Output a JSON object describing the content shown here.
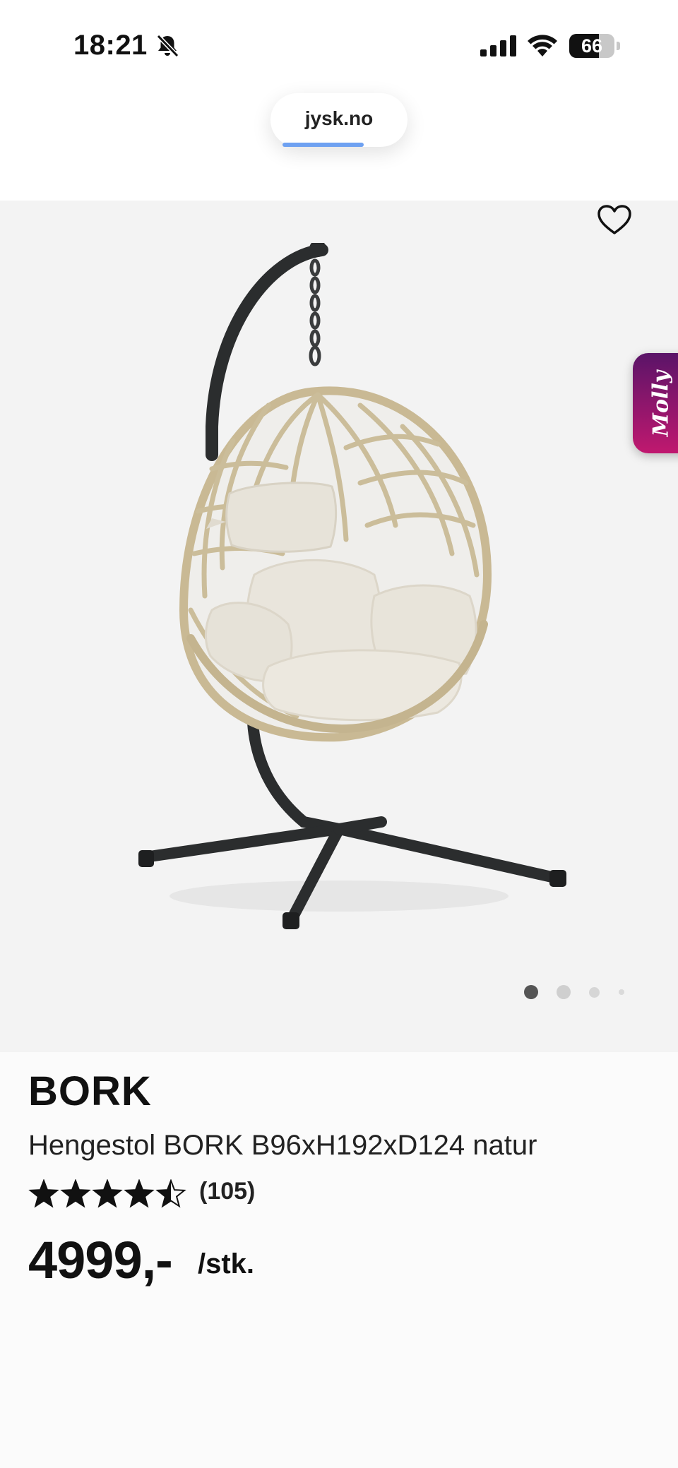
{
  "status_bar": {
    "time": "18:21",
    "battery_level": "66",
    "icons": [
      "bell-slash-icon",
      "signal-icon",
      "wifi-icon",
      "battery-icon"
    ]
  },
  "browser": {
    "url": "jysk.no",
    "load_progress_percent": 72
  },
  "gallery": {
    "image_icon": "hanging-egg-chair-image",
    "favorite_icon": "heart-outline-icon",
    "chat_widget_label": "Molly",
    "image_count": 4,
    "active_index": 0
  },
  "product": {
    "brand": "BORK",
    "name": "Hengestol BORK B96xH192xD124 natur",
    "rating": 4.5,
    "rating_max": 5,
    "review_count": "(105)",
    "price": "4999,-",
    "unit": "/stk."
  },
  "colors": {
    "accent_progress": "#6ea1f1",
    "chat_gradient_top": "#5a1468",
    "chat_gradient_bottom": "#c0186f",
    "gallery_background": "#f3f3f3"
  }
}
